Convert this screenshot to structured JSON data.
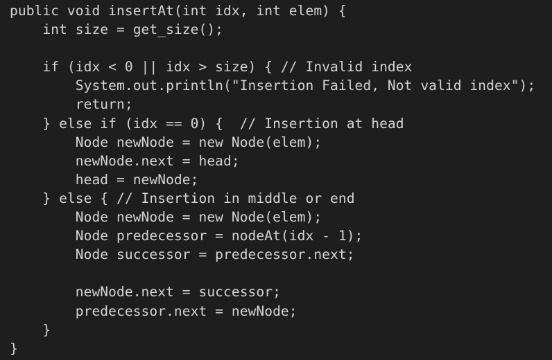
{
  "editor": {
    "background": "#1e1e1e",
    "text_color": "#d4d4d4",
    "lines": [
      {
        "text": "public void insertAt(int idx, int elem) {"
      },
      {
        "text": "    int size = get_size();"
      },
      {
        "text": ""
      },
      {
        "text": "    if (idx < 0 || idx > size) { // Invalid index"
      },
      {
        "text": "        System.out.println(\"Insertion Failed, Not valid index\");"
      },
      {
        "text": "        return;"
      },
      {
        "text": "    } else if (idx == 0) {  // Insertion at head"
      },
      {
        "text": "        Node newNode = new Node(elem);"
      },
      {
        "text": "        newNode.next = head;"
      },
      {
        "text": "        head = newNode;"
      },
      {
        "text": "    } else { // Insertion in middle or end"
      },
      {
        "text": "        Node newNode = new Node(elem);"
      },
      {
        "text": "        Node predecessor = nodeAt(idx - 1);"
      },
      {
        "text": "        Node successor = predecessor.next;"
      },
      {
        "text": ""
      },
      {
        "text": "        newNode.next = successor;"
      },
      {
        "text": "        predecessor.next = newNode;"
      },
      {
        "text": "    }"
      },
      {
        "text": "}"
      }
    ]
  }
}
